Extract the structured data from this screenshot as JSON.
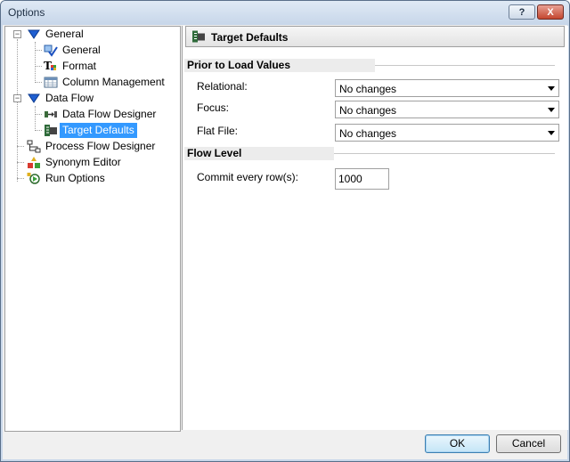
{
  "window": {
    "title": "Options",
    "help_label": "?",
    "close_label": "X"
  },
  "tree": {
    "general": "General",
    "general_general": "General",
    "general_format": "Format",
    "general_columns": "Column Management",
    "dataflow": "Data Flow",
    "dataflow_designer": "Data Flow Designer",
    "dataflow_target": "Target Defaults",
    "processflow": "Process Flow Designer",
    "synonym": "Synonym Editor",
    "run": "Run Options",
    "expander_general": "−",
    "expander_dataflow": "−"
  },
  "panel": {
    "header": "Target Defaults",
    "section_load": "Prior to Load Values",
    "relational_label": "Relational:",
    "relational_value": "No changes",
    "focus_label": "Focus:",
    "focus_value": "No changes",
    "flatfile_label": "Flat File:",
    "flatfile_value": "No changes",
    "section_flow": "Flow Level",
    "commit_label": "Commit every row(s):",
    "commit_value": "1000"
  },
  "buttons": {
    "ok": "OK",
    "cancel": "Cancel"
  },
  "colors": {
    "selection": "#3399ff",
    "titlebar": "#c7d6e9"
  }
}
